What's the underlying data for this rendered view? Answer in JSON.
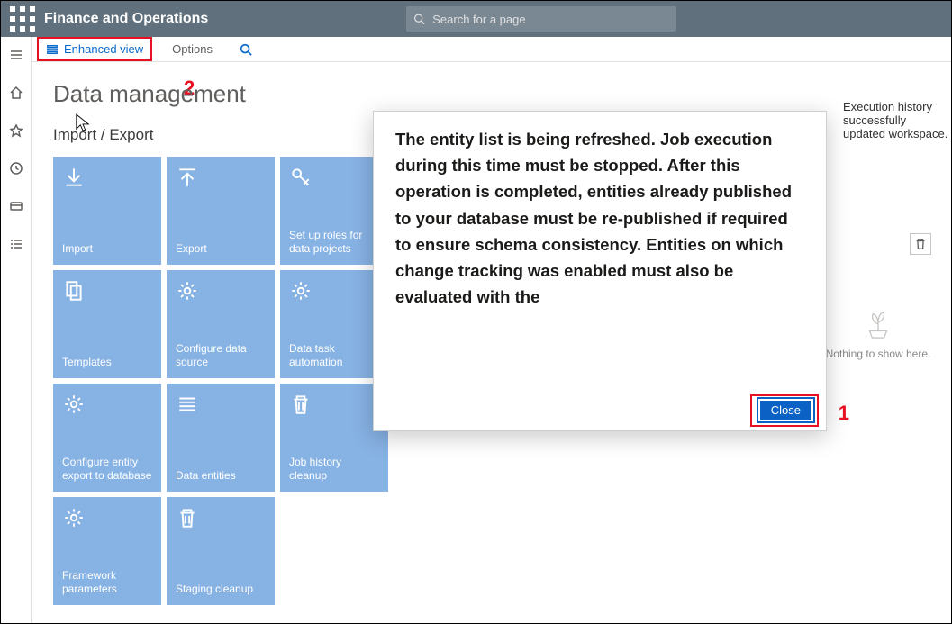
{
  "header": {
    "brand": "Finance and Operations",
    "search_placeholder": "Search for a page"
  },
  "cmdbar": {
    "enhanced_view": "Enhanced view",
    "options": "Options"
  },
  "annotations": {
    "one": "1",
    "two": "2"
  },
  "workspace": {
    "title": "Data management",
    "section": "Import / Export",
    "tiles": [
      {
        "label": "Import",
        "icon": "download-icon"
      },
      {
        "label": "Export",
        "icon": "upload-icon"
      },
      {
        "label": "Set up roles for data projects",
        "icon": "key-icon"
      },
      {
        "label": "Templates",
        "icon": "copy-icon"
      },
      {
        "label": "Configure data source",
        "icon": "gear-icon"
      },
      {
        "label": "Data task automation",
        "icon": "gear-icon"
      },
      {
        "label": "Configure entity export to database",
        "icon": "gear-icon"
      },
      {
        "label": "Data entities",
        "icon": "list-icon"
      },
      {
        "label": "Job history cleanup",
        "icon": "trash-icon"
      },
      {
        "label": "Framework parameters",
        "icon": "gear-icon"
      },
      {
        "label": "Staging cleanup",
        "icon": "trash-icon"
      }
    ]
  },
  "notification": {
    "text": "Execution history successfully updated workspace."
  },
  "empty": {
    "text": "Nothing to show here."
  },
  "dialog": {
    "body": "The entity list is being refreshed. Job execution during this time must be stopped. After this operation is completed, entities already published to your database must be re-published if required to ensure schema consistency. Entities on which change tracking was enabled must also be evaluated with the",
    "close": "Close"
  }
}
